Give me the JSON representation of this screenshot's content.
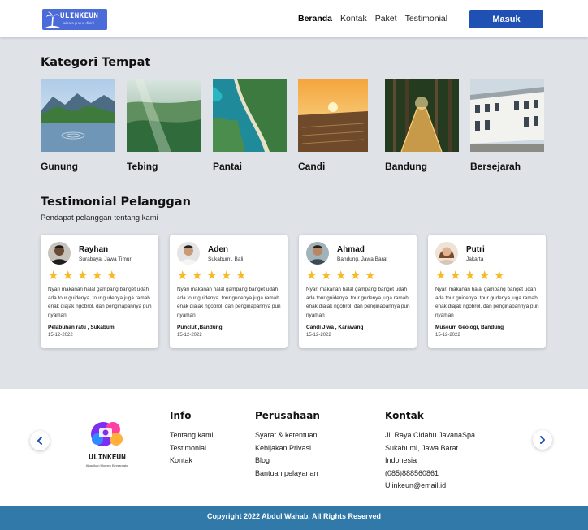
{
  "header": {
    "logo_text": "ULINKEUN",
    "logo_tagline": "wisata yuuuu disini",
    "nav": [
      {
        "label": "Beranda",
        "active": true
      },
      {
        "label": "Kontak",
        "active": false
      },
      {
        "label": "Paket",
        "active": false
      },
      {
        "label": "Testimonial",
        "active": false
      }
    ],
    "login_label": "Masuk"
  },
  "categories": {
    "title": "Kategori Tempat",
    "items": [
      {
        "label": "Gunung",
        "image": "mountain-lake-photo"
      },
      {
        "label": "Tebing",
        "image": "green-valley-photo"
      },
      {
        "label": "Pantai",
        "image": "coast-aerial-photo"
      },
      {
        "label": "Candi",
        "image": "temple-sunset-photo"
      },
      {
        "label": "Bandung",
        "image": "forest-bridge-photo"
      },
      {
        "label": "Bersejarah",
        "image": "museum-building-photo"
      }
    ]
  },
  "testimonials": {
    "title": "Testimonial Pelanggan",
    "subtitle": "Pendapat pelanggan tentang kami",
    "cards": [
      {
        "name": "Rayhan",
        "city": "Surabaya, Jawa Timur",
        "rating": 5,
        "quote": "Nyari makanan halal gampang banget udah ada tour guidenya. tour gudenya juga ramah enak diajak ngobrol, dan penginapannya pun nyaman",
        "place": "Pelabuhan ratu , Sukabumi",
        "date": "15-12-2022"
      },
      {
        "name": "Aden",
        "city": "Sukabumi, Bali",
        "rating": 5,
        "quote": "Nyari makanan halal gampang banget udah ada tour guidenya. tour gudenya juga ramah enak diajak ngobrol, dan penginapannya pun nyaman",
        "place": "Punclut ,Bandung",
        "date": "15-12-2022"
      },
      {
        "name": "Ahmad",
        "city": "Bandung, Jawa Barat",
        "rating": 5,
        "quote": "Nyari makanan halal gampang banget udah ada tour guidenya. tour gudenya juga ramah enak diajak ngobrol, dan penginapannya pun nyaman",
        "place": "Candi Jiwa , Karawang",
        "date": "15-12-2022"
      },
      {
        "name": "Putri",
        "city": "Jakarta",
        "rating": 5,
        "quote": "Nyari makanan halal gampang banget udah ada tour guidenya. tour gudenya juga ramah enak diajak ngobrol, dan penginapannya pun nyaman",
        "place": "Museum Geologi, Bandung",
        "date": "15-12-2022"
      }
    ]
  },
  "footer": {
    "logo_text": "ULINKEUN",
    "logo_tagline": "Abadikan Momen Bersamaku",
    "info": {
      "title": "Info",
      "links": [
        "Tentang kami",
        "Testimonial",
        "Kontak"
      ]
    },
    "company": {
      "title": "Perusahaan",
      "links": [
        "Syarat & ketentuan",
        "Kebijakan Privasi",
        "Blog",
        "Bantuan pelayanan"
      ]
    },
    "contact": {
      "title": "Kontak",
      "lines": [
        "Jl. Raya Cidahu JavanaSpa",
        "Sukabumi, Jawa Barat",
        "Indonesia",
        "(085)888560861",
        "Ulinkeun@email.id"
      ]
    },
    "copyright": "Copyright 2022 Abdul Wahab. All Rights Reserved"
  },
  "colors": {
    "primary": "#1f50b3",
    "footer_bar": "#3079a8",
    "star": "#f7b924",
    "background": "#dfe3e8"
  }
}
